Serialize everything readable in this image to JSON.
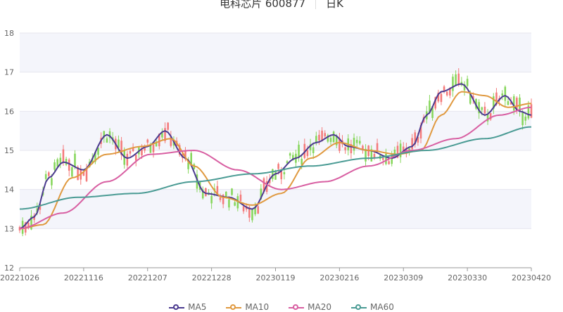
{
  "header": {
    "title": "电科芯片 600877",
    "period": "日K"
  },
  "chart_data": {
    "type": "candlestick",
    "ylim": [
      12,
      18
    ],
    "yticks": [
      12,
      13,
      14,
      15,
      16,
      17,
      18
    ],
    "x_ticks": [
      "20221026",
      "20221116",
      "20221207",
      "20221228",
      "20230119",
      "20230216",
      "20230309",
      "20230330",
      "20230420"
    ],
    "grid": true,
    "legend_position": "bottom",
    "colors": {
      "up": "#f47a7a",
      "down": "#86d65b",
      "band": "#f4f5fb"
    },
    "ma": [
      {
        "name": "MA5",
        "color": "#4b3a8f",
        "values": [
          [
            0,
            13.0
          ],
          [
            5,
            13.3
          ],
          [
            10,
            14.3
          ],
          [
            15,
            14.7
          ],
          [
            22,
            14.5
          ],
          [
            30,
            15.4
          ],
          [
            37,
            14.8
          ],
          [
            44,
            15.1
          ],
          [
            50,
            15.5
          ],
          [
            57,
            14.8
          ],
          [
            64,
            13.9
          ],
          [
            72,
            13.8
          ],
          [
            80,
            13.5
          ],
          [
            88,
            14.4
          ],
          [
            95,
            14.8
          ],
          [
            102,
            15.2
          ],
          [
            108,
            15.4
          ],
          [
            113,
            15.1
          ],
          [
            120,
            15.0
          ],
          [
            128,
            14.8
          ],
          [
            135,
            15.1
          ],
          [
            140,
            15.9
          ],
          [
            145,
            16.5
          ],
          [
            152,
            16.7
          ],
          [
            160,
            15.9
          ],
          [
            167,
            16.4
          ],
          [
            172,
            16.0
          ],
          [
            176,
            15.9
          ]
        ]
      },
      {
        "name": "MA10",
        "color": "#e0993f",
        "values": [
          [
            0,
            13.0
          ],
          [
            8,
            13.1
          ],
          [
            18,
            14.3
          ],
          [
            30,
            14.9
          ],
          [
            42,
            15.1
          ],
          [
            52,
            15.3
          ],
          [
            60,
            14.6
          ],
          [
            70,
            13.8
          ],
          [
            80,
            13.6
          ],
          [
            90,
            13.9
          ],
          [
            100,
            14.8
          ],
          [
            110,
            15.2
          ],
          [
            120,
            15.0
          ],
          [
            130,
            14.9
          ],
          [
            138,
            15.0
          ],
          [
            145,
            15.9
          ],
          [
            152,
            16.5
          ],
          [
            160,
            16.4
          ],
          [
            168,
            16.1
          ],
          [
            176,
            16.2
          ]
        ]
      },
      {
        "name": "MA20",
        "color": "#d85fa2",
        "values": [
          [
            0,
            13.0
          ],
          [
            15,
            13.4
          ],
          [
            30,
            14.2
          ],
          [
            45,
            14.9
          ],
          [
            60,
            15.0
          ],
          [
            75,
            14.5
          ],
          [
            90,
            14.0
          ],
          [
            105,
            14.2
          ],
          [
            120,
            14.6
          ],
          [
            135,
            15.0
          ],
          [
            150,
            15.3
          ],
          [
            165,
            15.9
          ],
          [
            176,
            16.1
          ]
        ]
      },
      {
        "name": "MA60",
        "color": "#4a9b94",
        "values": [
          [
            0,
            13.5
          ],
          [
            20,
            13.8
          ],
          [
            40,
            13.9
          ],
          [
            60,
            14.2
          ],
          [
            80,
            14.4
          ],
          [
            100,
            14.6
          ],
          [
            120,
            14.8
          ],
          [
            140,
            15.0
          ],
          [
            160,
            15.3
          ],
          [
            176,
            15.6
          ]
        ]
      }
    ]
  }
}
